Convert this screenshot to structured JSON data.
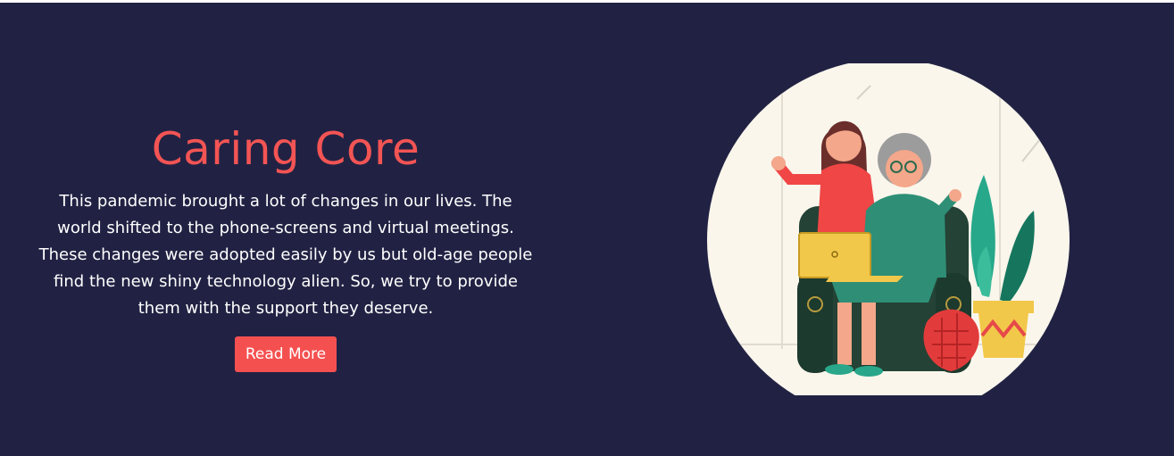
{
  "hero": {
    "title": "Caring Core",
    "description": "This pandemic brought a lot of changes in our lives. The world shifted to the phone-screens and virtual meetings. These changes were adopted easily by us but old-age people find the new shiny technology alien. So, we try to provide them with the support they deserve.",
    "cta_label": "Read More"
  },
  "colors": {
    "background": "#212243",
    "accent": "#f35454",
    "button": "#f55050",
    "text": "#ffffff"
  },
  "illustration": {
    "icon": "caregiver-with-elderly-woman-illustration"
  }
}
